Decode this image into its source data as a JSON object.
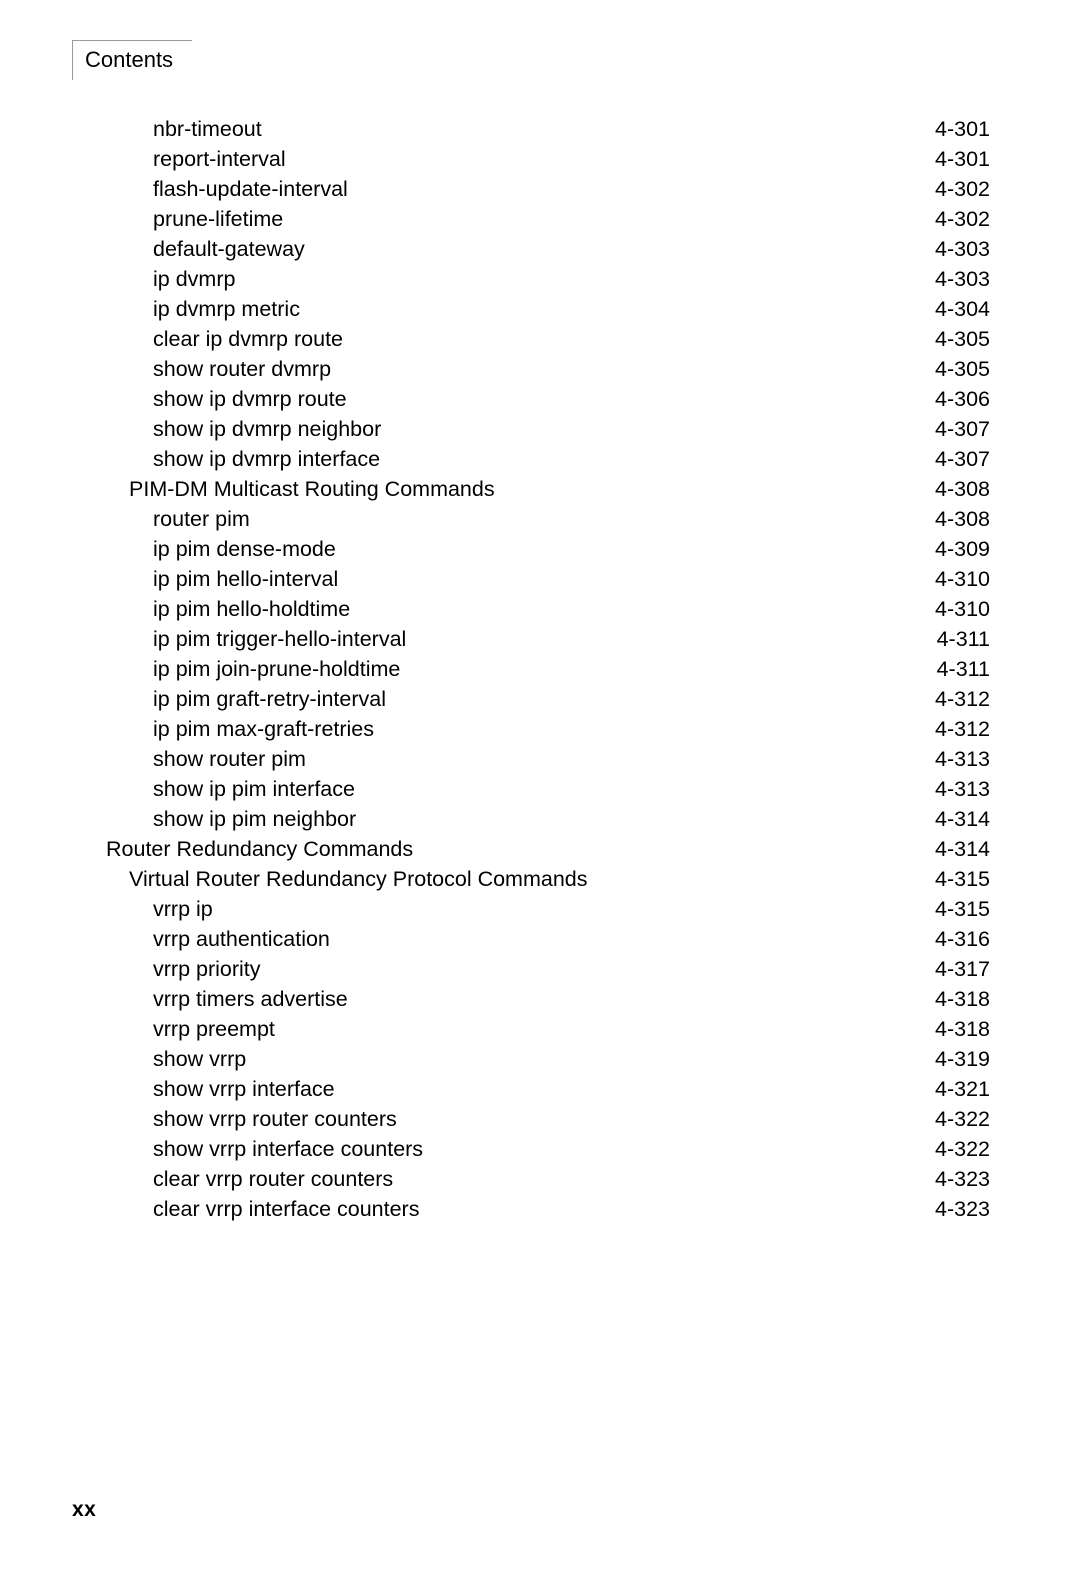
{
  "header": {
    "title": "Contents"
  },
  "footer": {
    "page_label": "xx"
  },
  "toc": {
    "entries": [
      {
        "label": "nbr-timeout",
        "page": "4-301",
        "level": 3
      },
      {
        "label": "report-interval",
        "page": "4-301",
        "level": 3
      },
      {
        "label": "flash-update-interval",
        "page": "4-302",
        "level": 3
      },
      {
        "label": "prune-lifetime",
        "page": "4-302",
        "level": 3
      },
      {
        "label": "default-gateway",
        "page": "4-303",
        "level": 3
      },
      {
        "label": "ip dvmrp",
        "page": "4-303",
        "level": 3
      },
      {
        "label": "ip dvmrp metric",
        "page": "4-304",
        "level": 3
      },
      {
        "label": "clear ip dvmrp route",
        "page": "4-305",
        "level": 3
      },
      {
        "label": "show router dvmrp",
        "page": "4-305",
        "level": 3
      },
      {
        "label": "show ip dvmrp route",
        "page": "4-306",
        "level": 3
      },
      {
        "label": "show ip dvmrp neighbor",
        "page": "4-307",
        "level": 3
      },
      {
        "label": "show ip dvmrp interface",
        "page": "4-307",
        "level": 3
      },
      {
        "label": "PIM-DM Multicast Routing Commands",
        "page": "4-308",
        "level": 2
      },
      {
        "label": "router pim",
        "page": "4-308",
        "level": 3
      },
      {
        "label": "ip pim dense-mode",
        "page": "4-309",
        "level": 3
      },
      {
        "label": "ip pim hello-interval",
        "page": "4-310",
        "level": 3
      },
      {
        "label": "ip pim hello-holdtime",
        "page": "4-310",
        "level": 3
      },
      {
        "label": "ip pim trigger-hello-interval",
        "page": "4-311",
        "level": 3
      },
      {
        "label": "ip pim join-prune-holdtime",
        "page": "4-311",
        "level": 3
      },
      {
        "label": "ip pim graft-retry-interval",
        "page": "4-312",
        "level": 3
      },
      {
        "label": "ip pim max-graft-retries",
        "page": "4-312",
        "level": 3
      },
      {
        "label": "show router pim",
        "page": "4-313",
        "level": 3
      },
      {
        "label": "show ip pim interface",
        "page": "4-313",
        "level": 3
      },
      {
        "label": "show ip pim neighbor",
        "page": "4-314",
        "level": 3
      },
      {
        "label": "Router Redundancy Commands",
        "page": "4-314",
        "level": 1
      },
      {
        "label": "Virtual Router Redundancy Protocol Commands",
        "page": "4-315",
        "level": 2
      },
      {
        "label": "vrrp ip",
        "page": "4-315",
        "level": 3
      },
      {
        "label": "vrrp authentication",
        "page": "4-316",
        "level": 3
      },
      {
        "label": "vrrp priority",
        "page": "4-317",
        "level": 3
      },
      {
        "label": "vrrp timers advertise",
        "page": "4-318",
        "level": 3
      },
      {
        "label": "vrrp preempt",
        "page": "4-318",
        "level": 3
      },
      {
        "label": "show vrrp",
        "page": "4-319",
        "level": 3
      },
      {
        "label": "show vrrp interface",
        "page": "4-321",
        "level": 3
      },
      {
        "label": "show vrrp router counters",
        "page": "4-322",
        "level": 3
      },
      {
        "label": "show vrrp interface counters",
        "page": "4-322",
        "level": 3
      },
      {
        "label": "clear vrrp router counters",
        "page": "4-323",
        "level": 3
      },
      {
        "label": "clear vrrp interface counters",
        "page": "4-323",
        "level": 3
      }
    ]
  }
}
